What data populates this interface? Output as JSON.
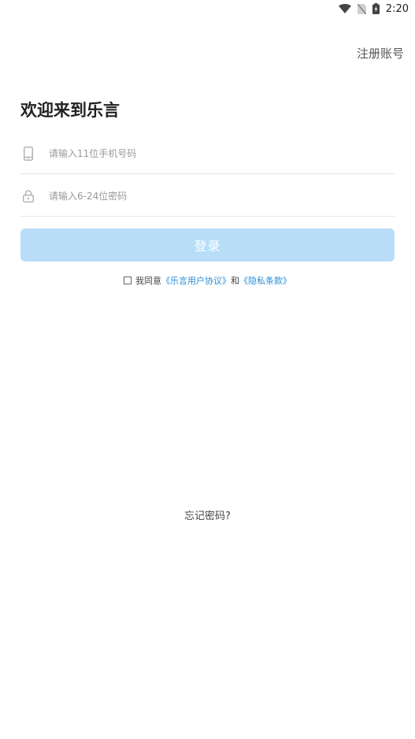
{
  "status_bar": {
    "time": "2:20",
    "icons": [
      "wifi-icon",
      "no-sim-icon",
      "battery-charging-icon"
    ]
  },
  "header": {
    "register_label": "注册账号"
  },
  "main": {
    "welcome_title": "欢迎来到乐言",
    "phone_input": {
      "placeholder": "请输入11位手机号码",
      "value": "",
      "icon": "phone-icon"
    },
    "password_input": {
      "placeholder": "请输入6-24位密码",
      "value": "",
      "icon": "lock-icon"
    },
    "login_label": "登录",
    "login_button_color": "#b7ddf9",
    "agreement": {
      "prefix": "我同意",
      "user_agreement": "《乐言用户协议》",
      "and": "和",
      "privacy_policy": "《隐私条款》",
      "link_color": "#2a8bd6"
    },
    "forgot_password": "忘记密码?"
  }
}
